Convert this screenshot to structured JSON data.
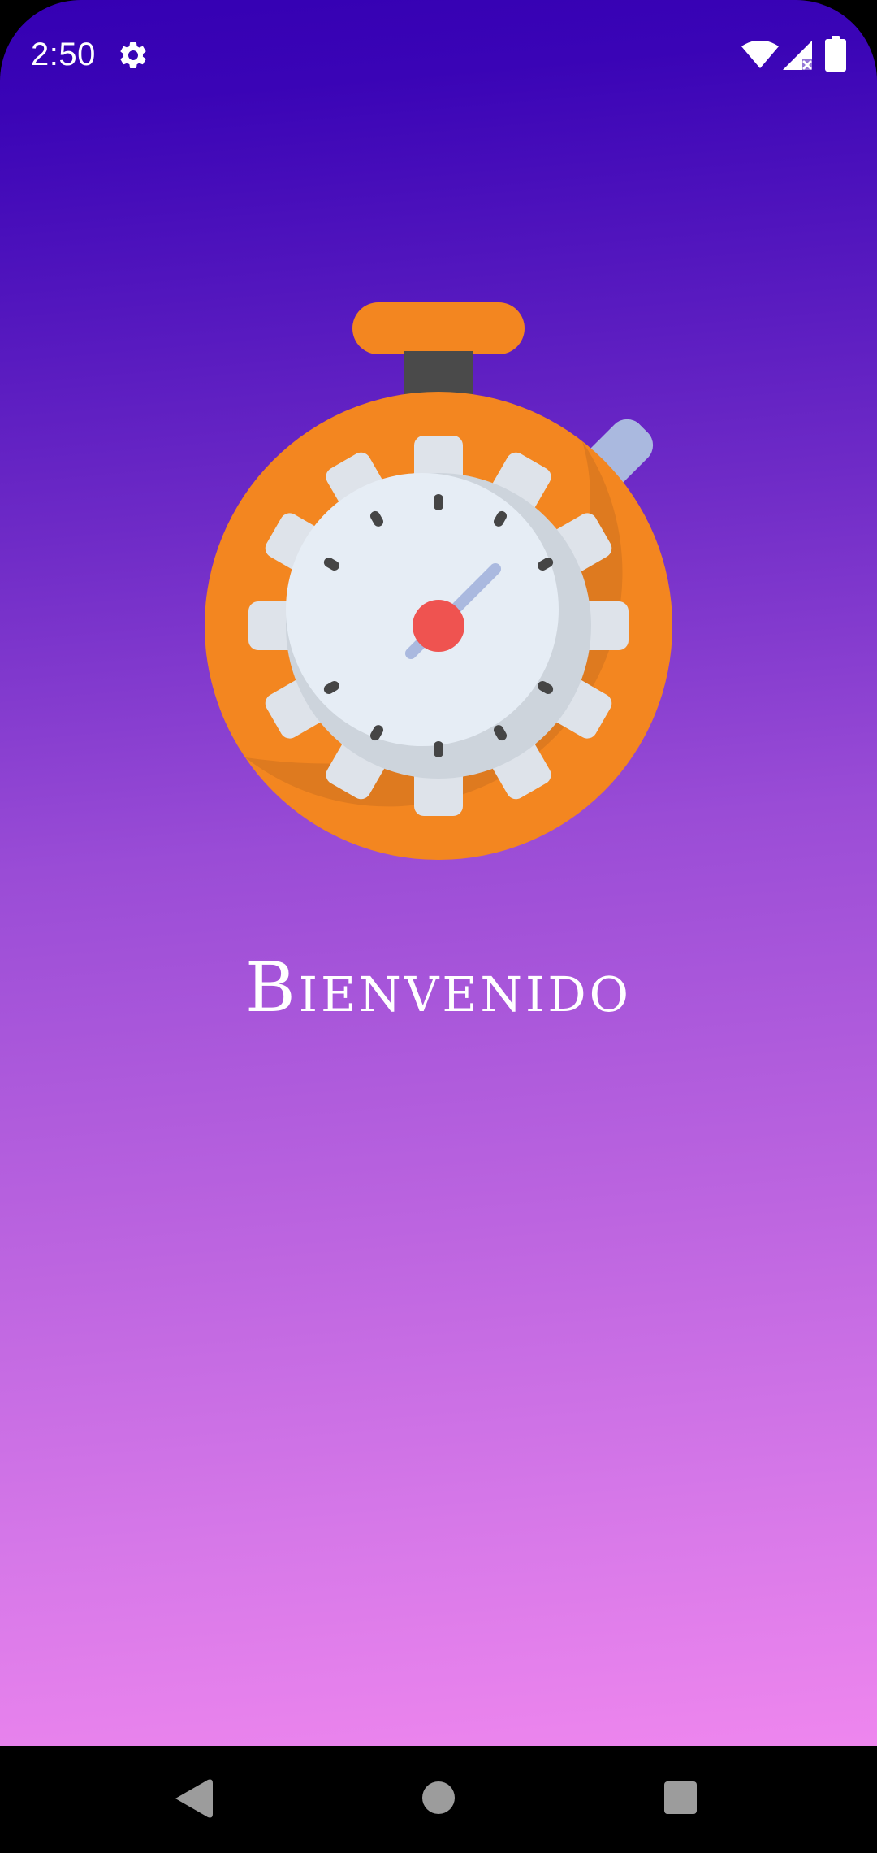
{
  "status_bar": {
    "time": "2:50",
    "icons": [
      "gear-icon",
      "wifi-icon",
      "cell-signal-no-service-icon",
      "battery-icon"
    ]
  },
  "splash": {
    "illustration": "stopwatch-icon",
    "welcome_text": "Bienvenido"
  },
  "navigation_bar": {
    "buttons": [
      "back-button",
      "home-button",
      "recents-button"
    ]
  },
  "colors": {
    "gradient_top": "#3500b3",
    "gradient_bottom": "#ee86ee",
    "stopwatch_orange": "#f38620",
    "stopwatch_face": "#e6edf5",
    "stopwatch_center": "#ef5350"
  }
}
